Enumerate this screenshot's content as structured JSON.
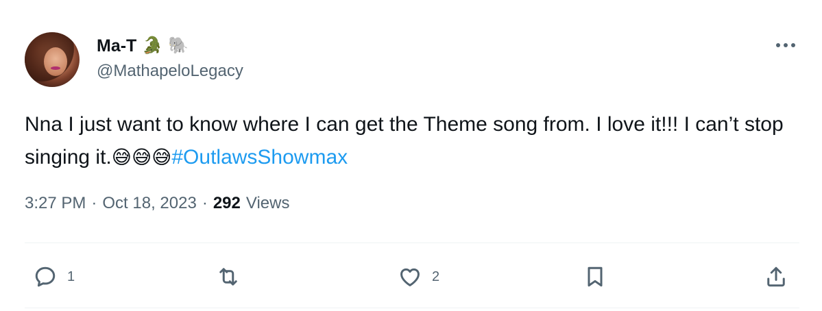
{
  "author": {
    "display_name": "Ma-T",
    "name_emojis": [
      "🐊",
      "🐘"
    ],
    "handle": "@MathapeloLegacy"
  },
  "tweet": {
    "text_before_hashtag": "Nna I just want to know where I can get the Theme song from. I love it!!! I can’t stop singing it.",
    "emojis": [
      "😅",
      "😅",
      "😅"
    ],
    "hashtag": "#OutlawsShowmax"
  },
  "meta": {
    "time": "3:27 PM",
    "separator": "·",
    "date": "Oct 18, 2023",
    "views_count": "292",
    "views_label": "Views"
  },
  "actions": {
    "reply_count": "1",
    "like_count": "2"
  },
  "icons": {
    "more": "more-horizontal-icon",
    "reply": "reply-bubble-icon",
    "retweet": "retweet-icon",
    "like": "heart-icon",
    "bookmark": "bookmark-icon",
    "share": "share-upload-icon"
  },
  "colors": {
    "link": "#1d9bf0",
    "secondary_text": "#536471",
    "primary_text": "#0f1419",
    "divider": "#eff3f4"
  }
}
